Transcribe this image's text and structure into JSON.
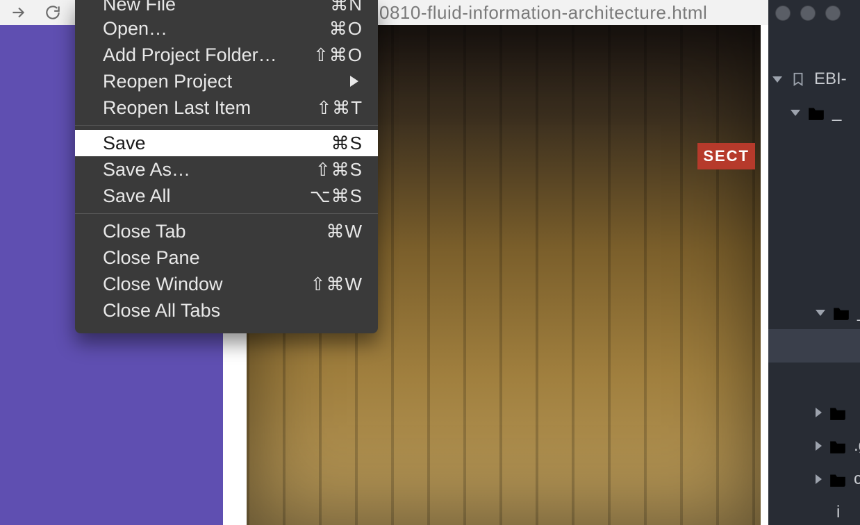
{
  "toolbar": {
    "address_fragment": "0810-fluid-information-architecture.html"
  },
  "menu": {
    "groups": [
      [
        {
          "label": "New File",
          "shortcut": "⌘N"
        },
        {
          "label": "Open…",
          "shortcut": "⌘O"
        },
        {
          "label": "Add Project Folder…",
          "shortcut": "⇧⌘O"
        },
        {
          "label": "Reopen Project",
          "submenu": true
        },
        {
          "label": "Reopen Last Item",
          "shortcut": "⇧⌘T"
        }
      ],
      [
        {
          "label": "Save",
          "shortcut": "⌘S",
          "highlight": true
        },
        {
          "label": "Save As…",
          "shortcut": "⇧⌘S"
        },
        {
          "label": "Save All",
          "shortcut": "⌥⌘S"
        }
      ],
      [
        {
          "label": "Close Tab",
          "shortcut": "⌘W"
        },
        {
          "label": "Close Pane",
          "shortcut": ""
        },
        {
          "label": "Close Window",
          "shortcut": "⇧⌘W"
        },
        {
          "label": "Close All Tabs",
          "shortcut": ""
        }
      ]
    ]
  },
  "photo": {
    "sign": "SECT"
  },
  "editor": {
    "project_label": "EBI-",
    "tree": [
      {
        "type": "folder-green",
        "disclosure": "open",
        "indent": 1,
        "label": "_"
      },
      {
        "type": "file-green",
        "disclosure": "",
        "indent": 3,
        "label": ""
      },
      {
        "type": "file-green",
        "disclosure": "",
        "indent": 3,
        "label": ""
      },
      {
        "type": "file-green",
        "disclosure": "",
        "indent": 3,
        "label": ""
      },
      {
        "type": "file-green",
        "disclosure": "",
        "indent": 3,
        "label": ""
      },
      {
        "type": "file-green",
        "disclosure": "",
        "indent": 3,
        "label": ""
      },
      {
        "type": "folder-green",
        "disclosure": "open",
        "indent": 2,
        "label": "_"
      },
      {
        "type": "file-green",
        "disclosure": "",
        "indent": 3,
        "label": "",
        "selected": true
      },
      {
        "type": "file-green",
        "disclosure": "",
        "indent": 3,
        "label": ""
      },
      {
        "type": "folder-grey",
        "disclosure": "closed",
        "indent": 2,
        "label": ""
      },
      {
        "type": "folder-grey",
        "disclosure": "closed",
        "indent": 2,
        "label": ".g"
      },
      {
        "type": "folder-amber",
        "disclosure": "closed",
        "indent": 2,
        "label": "c"
      },
      {
        "type": "",
        "disclosure": "",
        "indent": 3,
        "label": "i"
      }
    ]
  }
}
